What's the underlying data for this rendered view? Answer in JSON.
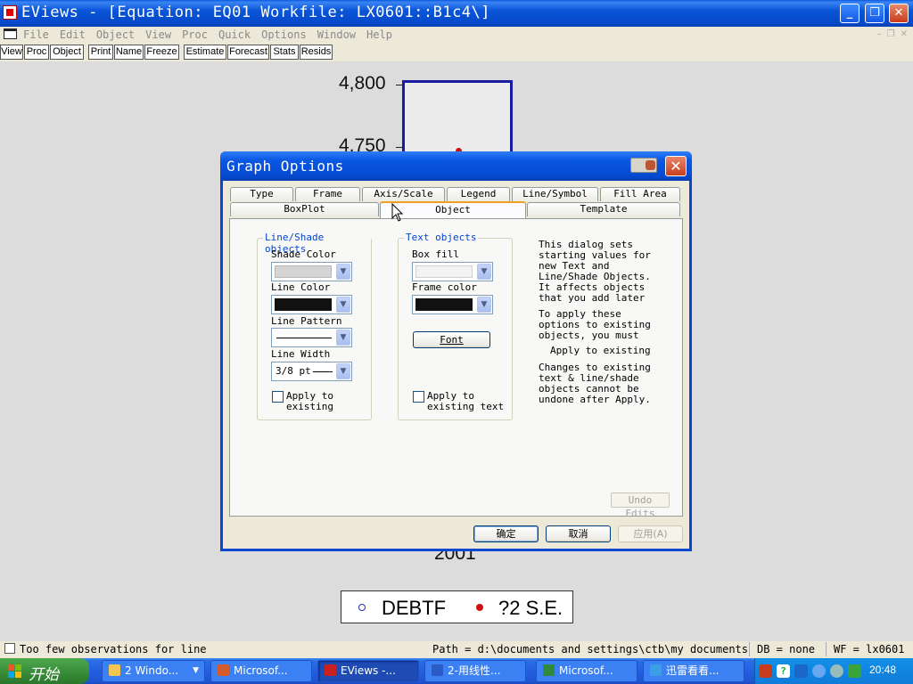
{
  "window": {
    "title": "EViews - [Equation: EQ01   Workfile: LX0601::B1c4\\]"
  },
  "menu": [
    "File",
    "Edit",
    "Object",
    "View",
    "Proc",
    "Quick",
    "Options",
    "Window",
    "Help"
  ],
  "toolbar": [
    "View",
    "Proc",
    "Object",
    "Print",
    "Name",
    "Freeze",
    "Estimate",
    "Forecast",
    "Stats",
    "Resids"
  ],
  "graph": {
    "ytick_top": "4,800",
    "ytick_second": "4,750",
    "xtick": "2001",
    "legend": [
      {
        "name": "DEBTF",
        "color": "#2233aa"
      },
      {
        "name": "?2 S.E.",
        "color": "#cc1111"
      }
    ]
  },
  "dialog": {
    "title": "Graph Options",
    "tabs_row1": [
      "Type",
      "Frame",
      "Axis/Scale",
      "Legend",
      "Line/Symbol",
      "Fill Area"
    ],
    "tabs_row2": [
      "BoxPlot",
      "Object",
      "Template"
    ],
    "selected_tab": "Object",
    "line_shade": {
      "caption": "Line/Shade objects",
      "shade_color_label": "Shade Color",
      "line_color_label": "Line Color",
      "line_pattern_label": "Line Pattern",
      "line_width_label": "Line Width",
      "line_width_value": "3/8 pt",
      "apply_label": "Apply to\nexisting",
      "shade_color": "#d4d4d4",
      "line_color": "#111111"
    },
    "text_objects": {
      "caption": "Text objects",
      "box_fill_label": "Box fill",
      "frame_color_label": "Frame color",
      "font_button": "Font",
      "apply_label": "Apply to\nexisting text",
      "box_fill_color": "#f2f2f2",
      "frame_color": "#111111"
    },
    "info": {
      "para1": "This dialog sets\nstarting values for\nnew Text and\nLine/Shade Objects.\nIt affects objects\nthat you add later",
      "para2": "To apply these\noptions to existing\nobjects, you must",
      "para3": "Apply to existing",
      "para4": "Changes to existing\ntext & line/shade\nobjects cannot be\nundone after Apply."
    },
    "undo_button": "Undo Edits",
    "ok_button": "确定",
    "cancel_button": "取消",
    "apply_button": "应用(A)"
  },
  "statusbar": {
    "message": "Too few observations for line",
    "path": "Path = d:\\documents and settings\\ctb\\my documents",
    "db": "DB = none",
    "wf": "WF = lx0601"
  },
  "taskbar": {
    "start_label": "开始",
    "tasks": [
      {
        "label": "2 Windo...",
        "icon": "folder-icon",
        "color": "#f3c552"
      },
      {
        "label": "Microsof...",
        "icon": "powerpoint-icon",
        "color": "#d55a2a"
      },
      {
        "label": "EViews -...",
        "icon": "eviews-icon",
        "color": "#c92020"
      },
      {
        "label": "2-用线性...",
        "icon": "word-icon",
        "color": "#2a5cc5"
      },
      {
        "label": "Microsof...",
        "icon": "excel-icon",
        "color": "#2f8a3c"
      },
      {
        "label": "迅雷看看...",
        "icon": "xunlei-icon",
        "color": "#3aa0e6"
      }
    ],
    "clock": "20:48"
  }
}
